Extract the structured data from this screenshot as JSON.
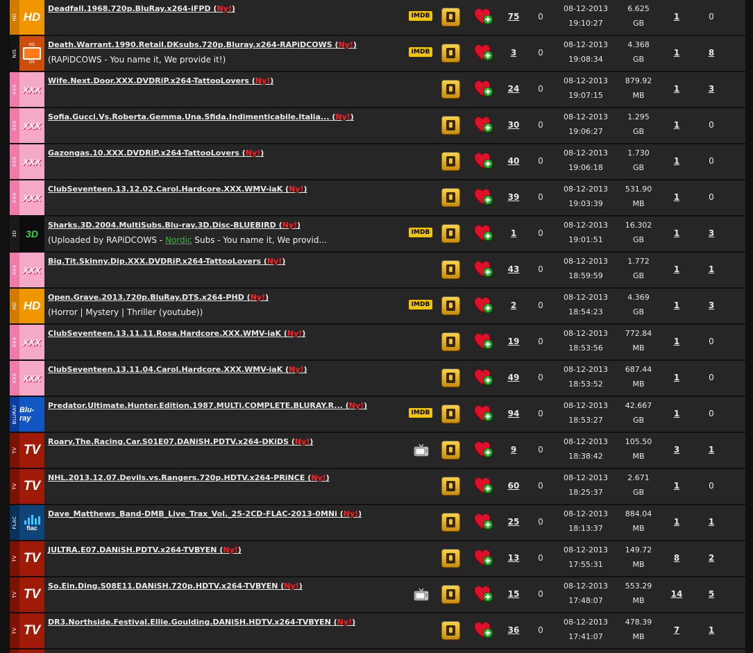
{
  "badge_new": "Ny!",
  "imdb_label": "IMDB",
  "colors": {
    "new": "#ff2020",
    "imdb": "#f0c400",
    "background": "#262626"
  },
  "icons": {
    "info": "info-icon",
    "favorite": "heart-plus-icon",
    "tv": "tv-icon"
  },
  "torrents": [
    {
      "cat": "hd",
      "strip": "HD",
      "badge": "HD",
      "name": "Deadfall.1968.720p.BluRay.x264-iFPD",
      "imdb": true,
      "seeders": "75",
      "leechers": "0",
      "date": "08-12-2013",
      "time": "19:10:27",
      "size": "6.625",
      "unit": "GB",
      "downloads": "1",
      "comments": "0"
    },
    {
      "cat": "nis",
      "strip": "NIS",
      "badge_top": "HD",
      "badge_bottom": "DK",
      "name": "Death.Warrant.1990.Retail.DKsubs.720p.Bluray.x264-RAPiDCOWS",
      "sub": "(RAPiDCOWS - You name it, We provide it!)",
      "imdb": true,
      "seeders": "3",
      "leechers": "0",
      "date": "08-12-2013",
      "time": "19:08:34",
      "size": "4.368",
      "unit": "GB",
      "downloads": "1",
      "comments": "8"
    },
    {
      "cat": "xxx",
      "strip": "XXX",
      "badge": "XXX",
      "name": "Wife.Next.Door.XXX.DVDRiP.x264-TattooLovers",
      "seeders": "24",
      "leechers": "0",
      "date": "08-12-2013",
      "time": "19:07:15",
      "size": "879.92",
      "unit": "MB",
      "downloads": "1",
      "comments": "3"
    },
    {
      "cat": "xxx",
      "strip": "XXX",
      "badge": "XXX",
      "name": "Sofia.Gucci.Vs.Roberta.Gemma.Una.Sfida.Indimenticabile.Italia...",
      "seeders": "30",
      "leechers": "0",
      "date": "08-12-2013",
      "time": "19:06:27",
      "size": "1.295",
      "unit": "GB",
      "downloads": "1",
      "comments": "0"
    },
    {
      "cat": "xxx",
      "strip": "XXX",
      "badge": "XXX",
      "name": "Gazongas.10.XXX.DVDRiP.x264-TattooLovers",
      "seeders": "40",
      "leechers": "0",
      "date": "08-12-2013",
      "time": "19:06:18",
      "size": "1.730",
      "unit": "GB",
      "downloads": "1",
      "comments": "0"
    },
    {
      "cat": "xxx",
      "strip": "XXX",
      "badge": "XXX",
      "name": "ClubSeventeen.13.12.02.Carol.Hardcore.XXX.WMV-iaK",
      "seeders": "39",
      "leechers": "0",
      "date": "08-12-2013",
      "time": "19:03:39",
      "size": "531.90",
      "unit": "MB",
      "downloads": "1",
      "comments": "0"
    },
    {
      "cat": "3d",
      "strip": "3D",
      "badge": "3D",
      "name": "Sharks.3D.2004.MultiSubs.Blu-ray.3D.Disc-BLUEBIRD",
      "sub_pre": "(Uploaded by RAPiDCOWS - ",
      "sub_link": "Nordic",
      "sub_post": " Subs - You name it, We provid...",
      "imdb": true,
      "seeders": "1",
      "leechers": "0",
      "date": "08-12-2013",
      "time": "19:01:51",
      "size": "16.302",
      "unit": "GB",
      "downloads": "1",
      "comments": "3"
    },
    {
      "cat": "xxx",
      "strip": "XXX",
      "badge": "XXX",
      "name": "Big.Tit.Skinny.Dip.XXX.DVDRiP.x264-TattooLovers",
      "seeders": "43",
      "leechers": "0",
      "date": "08-12-2013",
      "time": "18:59:59",
      "size": "1.772",
      "unit": "GB",
      "downloads": "1",
      "comments": "1"
    },
    {
      "cat": "hd",
      "strip": "HD",
      "badge": "HD",
      "name": "Open.Grave.2013.720p.BluRay.DTS.x264-PHD",
      "sub": "(Horror | Mystery | Thriller (youtube))",
      "imdb": true,
      "seeders": "2",
      "leechers": "0",
      "date": "08-12-2013",
      "time": "18:54:23",
      "size": "4.369",
      "unit": "GB",
      "downloads": "1",
      "comments": "3"
    },
    {
      "cat": "xxx",
      "strip": "XXX",
      "badge": "XXX",
      "name": "ClubSeventeen.13.11.11.Rosa.Hardcore.XXX.WMV-iaK",
      "seeders": "19",
      "leechers": "0",
      "date": "08-12-2013",
      "time": "18:53:56",
      "size": "772.84",
      "unit": "MB",
      "downloads": "1",
      "comments": "0"
    },
    {
      "cat": "xxx",
      "strip": "XXX",
      "badge": "XXX",
      "name": "ClubSeventeen.13.11.04.Carol.Hardcore.XXX.WMV-iaK",
      "seeders": "49",
      "leechers": "0",
      "date": "08-12-2013",
      "time": "18:53:52",
      "size": "687.44",
      "unit": "MB",
      "downloads": "1",
      "comments": "0"
    },
    {
      "cat": "bluray",
      "strip": "BLURAY",
      "badge": "Blu-ray",
      "name": "Predator.Ultimate.Hunter.Edition.1987.MULTi.COMPLETE.BLURAY.R...",
      "imdb": true,
      "seeders": "94",
      "leechers": "0",
      "date": "08-12-2013",
      "time": "18:53:27",
      "size": "42.667",
      "unit": "GB",
      "downloads": "1",
      "comments": "0"
    },
    {
      "cat": "tv",
      "strip": "TV",
      "badge": "TV",
      "name": "Roary.The.Racing.Car.S01E07.DANiSH.PDTV.x264-DKiDS",
      "tvicon": true,
      "seeders": "9",
      "leechers": "0",
      "date": "08-12-2013",
      "time": "18:38:42",
      "size": "105.50",
      "unit": "MB",
      "downloads": "3",
      "comments": "1"
    },
    {
      "cat": "tv",
      "strip": "TV",
      "badge": "TV",
      "name": "NHL.2013.12.07.Devils.vs.Rangers.720p.HDTV.x264-PRiNCE",
      "seeders": "60",
      "leechers": "0",
      "date": "08-12-2013",
      "time": "18:25:37",
      "size": "2.671",
      "unit": "GB",
      "downloads": "1",
      "comments": "0"
    },
    {
      "cat": "flac",
      "strip": "FLAC",
      "badge": "flac",
      "name": "Dave_Matthews_Band-DMB_Live_Trax_Vol._25-2CD-FLAC-2013-0MNi",
      "seeders": "25",
      "leechers": "0",
      "date": "08-12-2013",
      "time": "18:13:37",
      "size": "884.04",
      "unit": "MB",
      "downloads": "1",
      "comments": "1"
    },
    {
      "cat": "tv",
      "strip": "TV",
      "badge": "TV",
      "name": "JULTRA.E07.DANiSH.PDTV.x264-TVBYEN",
      "seeders": "13",
      "leechers": "0",
      "date": "08-12-2013",
      "time": "17:55:31",
      "size": "149.72",
      "unit": "MB",
      "downloads": "8",
      "comments": "2"
    },
    {
      "cat": "tv",
      "strip": "TV",
      "badge": "TV",
      "name": "So.Ein.Ding.S08E11.DANiSH.720p.HDTV.x264-TVBYEN",
      "tvicon": true,
      "seeders": "15",
      "leechers": "0",
      "date": "08-12-2013",
      "time": "17:48:07",
      "size": "553.29",
      "unit": "MB",
      "downloads": "14",
      "comments": "5"
    },
    {
      "cat": "tv",
      "strip": "TV",
      "badge": "TV",
      "name": "DR3.Northside.Festival.Ellie.Goulding.DANiSH.HDTV.x264-TVBYEN",
      "seeders": "36",
      "leechers": "0",
      "date": "08-12-2013",
      "time": "17:41:07",
      "size": "478.39",
      "unit": "MB",
      "downloads": "7",
      "comments": "1"
    }
  ]
}
